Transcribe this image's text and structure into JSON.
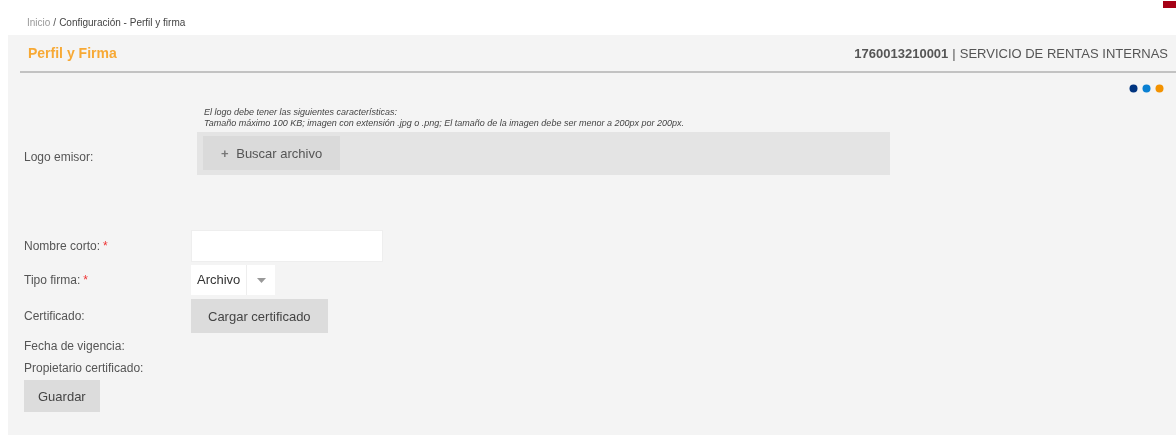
{
  "breadcrumb": {
    "home": "Inicio",
    "separator": "/",
    "current": "Configuración - Perfil y firma"
  },
  "header": {
    "title": "Perfil y Firma",
    "ruc": "1760013210001",
    "separator": "|",
    "entity": "SERVICIO DE RENTAS INTERNAS"
  },
  "logo": {
    "label": "Logo emisor:",
    "hint_lines": [
      "El logo debe tener las siguientes características:",
      "Tamaño máximo 100 KB; imagen con extensión .jpg o .png; El tamaño de la imagen debe ser menor a 200px por 200px."
    ],
    "button": {
      "icon": "+",
      "label": "Buscar archivo"
    }
  },
  "fields": [
    {
      "kind": "text",
      "label": "Nombre corto:",
      "required_mark": "*"
    },
    {
      "kind": "select",
      "label": "Tipo firma:",
      "required_mark": "*",
      "value": "Archivo"
    },
    {
      "kind": "button",
      "label": "Certificado:",
      "button": "Cargar certificado"
    },
    {
      "kind": "plain",
      "label": "Fecha de vigencia:"
    },
    {
      "kind": "plain",
      "label": "Propietario certificado:"
    }
  ],
  "save_button": "Guardar"
}
